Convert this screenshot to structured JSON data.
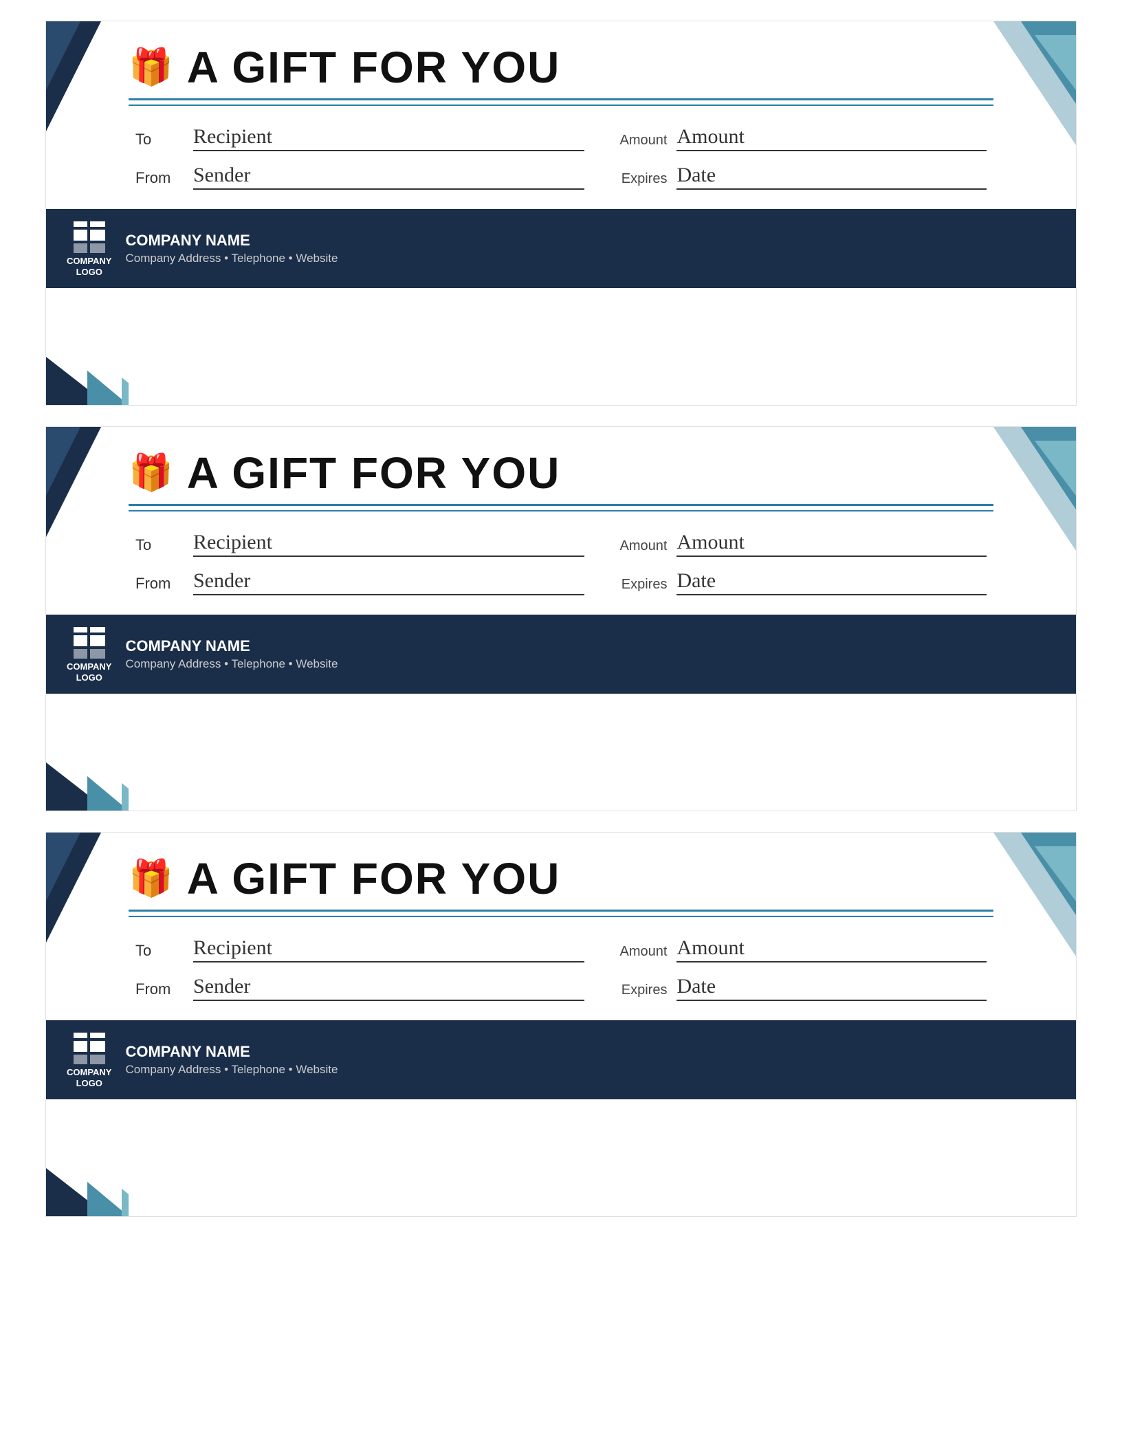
{
  "cards": [
    {
      "title": "A GIFT FOR YOU",
      "to_label": "To",
      "from_label": "From",
      "amount_label": "Amount",
      "expires_label": "Expires",
      "recipient_value": "Recipient",
      "sender_value": "Sender",
      "amount_value": "Amount",
      "date_value": "Date",
      "logo_line1": "COMPANY",
      "logo_line2": "LOGO",
      "company_name": "COMPANY NAME",
      "company_details": "Company Address • Telephone • Website"
    },
    {
      "title": "A GIFT FOR YOU",
      "to_label": "To",
      "from_label": "From",
      "amount_label": "Amount",
      "expires_label": "Expires",
      "recipient_value": "Recipient",
      "sender_value": "Sender",
      "amount_value": "Amount",
      "date_value": "Date",
      "logo_line1": "COMPANY",
      "logo_line2": "LOGO",
      "company_name": "COMPANY NAME",
      "company_details": "Company Address • Telephone • Website"
    },
    {
      "title": "A GIFT FOR YOU",
      "to_label": "To",
      "from_label": "From",
      "amount_label": "Amount",
      "expires_label": "Expires",
      "recipient_value": "Recipient",
      "sender_value": "Sender",
      "amount_value": "Amount",
      "date_value": "Date",
      "logo_line1": "COMPANY",
      "logo_line2": "LOGO",
      "company_name": "COMPANY NAME",
      "company_details": "Company Address • Telephone • Website"
    }
  ]
}
